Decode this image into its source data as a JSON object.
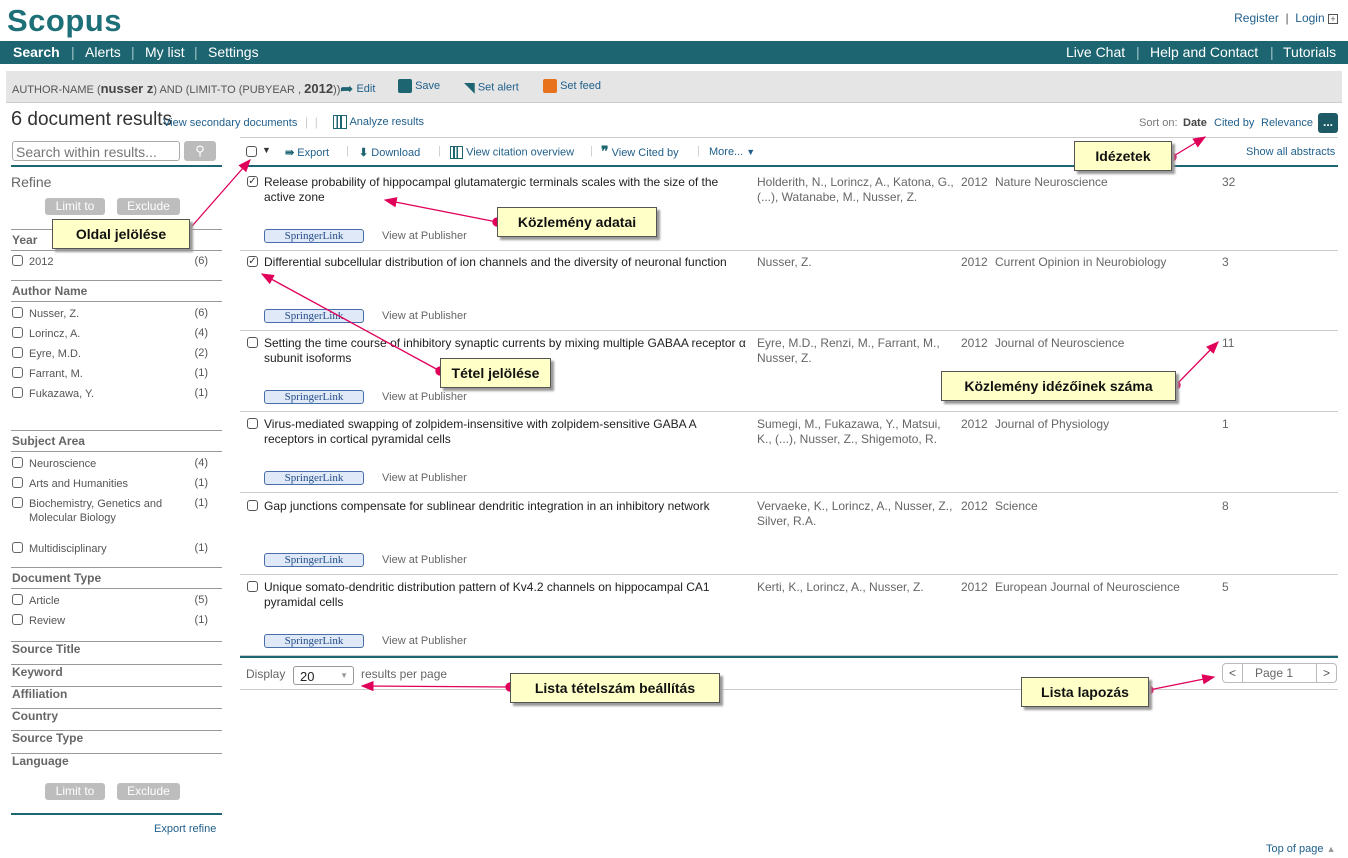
{
  "header": {
    "logo": "Scopus",
    "register": "Register",
    "login": "Login"
  },
  "nav": {
    "left": [
      "Search",
      "Alerts",
      "My list",
      "Settings"
    ],
    "right": [
      "Live Chat",
      "Help and Contact",
      "Tutorials"
    ]
  },
  "query": {
    "prefix": "AUTHOR-NAME (",
    "author": "nusser z",
    "mid": ") AND (LIMIT-TO (PUBYEAR , ",
    "year": "2012",
    "suffix": "))",
    "edit": "Edit",
    "save": "Save",
    "set_alert": "Set alert",
    "set_feed": "Set feed"
  },
  "results": {
    "count": "6",
    "label": "document results",
    "secondary": "View secondary documents",
    "analyze": "Analyze results"
  },
  "sort": {
    "label": "Sort on:",
    "date": "Date",
    "cited": "Cited by",
    "relevance": "Relevance",
    "more": "..."
  },
  "toolbar": {
    "export": "Export",
    "download": "Download",
    "citation_overview": "View citation overview",
    "cited_by": "View Cited by",
    "more": "More...",
    "show_abstracts": "Show all abstracts"
  },
  "sidebar": {
    "search_placeholder": "Search within results...",
    "refine": "Refine",
    "limit_to": "Limit to",
    "exclude": "Exclude",
    "export_refine": "Export refine",
    "year": {
      "title": "Year",
      "items": [
        {
          "label": "2012",
          "count": "(6)"
        }
      ]
    },
    "author": {
      "title": "Author Name",
      "items": [
        {
          "label": "Nusser, Z.",
          "count": "(6)"
        },
        {
          "label": "Lorincz, A.",
          "count": "(4)"
        },
        {
          "label": "Eyre, M.D.",
          "count": "(2)"
        },
        {
          "label": "Farrant, M.",
          "count": "(1)"
        },
        {
          "label": "Fukazawa, Y.",
          "count": "(1)"
        }
      ]
    },
    "subject": {
      "title": "Subject Area",
      "items": [
        {
          "label": "Neuroscience",
          "count": "(4)"
        },
        {
          "label": "Arts and Humanities",
          "count": "(1)"
        },
        {
          "label": "Biochemistry, Genetics and Molecular Biology",
          "count": "(1)"
        },
        {
          "label": "Multidisciplinary",
          "count": "(1)"
        }
      ]
    },
    "doctype": {
      "title": "Document Type",
      "items": [
        {
          "label": "Article",
          "count": "(5)"
        },
        {
          "label": "Review",
          "count": "(1)"
        }
      ]
    },
    "collapsed": [
      "Source Title",
      "Keyword",
      "Affiliation",
      "Country",
      "Source Type",
      "Language"
    ]
  },
  "rows": [
    {
      "checked": true,
      "title": "Release probability of hippocampal glutamatergic terminals scales with the size of the active zone",
      "authors": "Holderith, N., Lorincz, A., Katona, G., (...), Watanabe, M., Nusser, Z.",
      "year": "2012",
      "source": "Nature Neuroscience",
      "cited": "32"
    },
    {
      "checked": true,
      "title": "Differential subcellular distribution of ion channels and the diversity of neuronal function",
      "authors": "Nusser, Z.",
      "year": "2012",
      "source": "Current Opinion in Neurobiology",
      "cited": "3"
    },
    {
      "checked": false,
      "title": "Setting the time course of inhibitory synaptic currents by mixing multiple GABAA receptor α subunit isoforms",
      "authors": "Eyre, M.D., Renzi, M., Farrant, M., Nusser, Z.",
      "year": "2012",
      "source": "Journal of Neuroscience",
      "cited": "11"
    },
    {
      "checked": false,
      "title": "Virus-mediated swapping of zolpidem-insensitive with zolpidem-sensitive GABA A receptors in cortical pyramidal cells",
      "authors": "Sumegi, M., Fukazawa, Y., Matsui, K., (...), Nusser, Z., Shigemoto, R.",
      "year": "2012",
      "source": "Journal of Physiology",
      "cited": "1"
    },
    {
      "checked": false,
      "title": "Gap junctions compensate for sublinear dendritic integration in an inhibitory network",
      "authors": "Vervaeke, K., Lorincz, A., Nusser, Z., Silver, R.A.",
      "year": "2012",
      "source": "Science",
      "cited": "8"
    },
    {
      "checked": false,
      "title": "Unique somato-dendritic distribution pattern of Kv4.2 channels on hippocampal CA1 pyramidal cells",
      "authors": "Kerti, K., Lorincz, A., Nusser, Z.",
      "year": "2012",
      "source": "European Journal of Neuroscience",
      "cited": "5"
    }
  ],
  "row_links": {
    "springer": "SpringerLink",
    "publisher": "View at Publisher"
  },
  "footer": {
    "display": "Display",
    "per_page_value": "20",
    "per_page_label": "results per page",
    "page": "Page 1",
    "top_of_page": "Top of page"
  },
  "callouts": {
    "cited": "Idézetek",
    "pub_data": "Közlemény adatai",
    "select_page": "Oldal jelölése",
    "select_item": "Tétel jelölése",
    "citation_count": "Közlemény idézőinek száma",
    "per_page": "Lista tételszám beállítás",
    "paging": "Lista lapozás"
  },
  "colors": {
    "brand": "#1d6570",
    "link": "#1f5f8b",
    "callout_bg": "#ffffc8",
    "arrow": "#e0005a"
  }
}
